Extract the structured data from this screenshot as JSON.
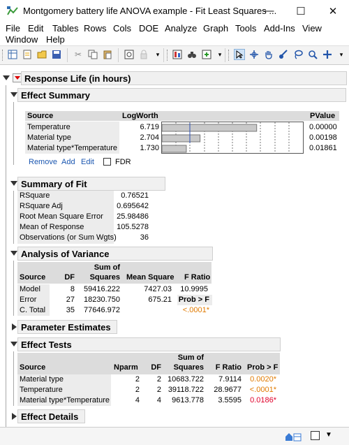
{
  "window": {
    "title": "Montgomery battery life ANOVA example - Fit Least Squares ...",
    "minimize": "—",
    "maximize": "☐",
    "close": "✕"
  },
  "menu": [
    "File",
    "Edit",
    "Tables",
    "Rows",
    "Cols",
    "DOE",
    "Analyze",
    "Graph",
    "Tools",
    "Add-Ins",
    "View",
    "Window",
    "Help"
  ],
  "report": {
    "title": "Response Life (in hours)",
    "effect_summary": {
      "title": "Effect Summary",
      "headers": {
        "source": "Source",
        "logworth": "LogWorth",
        "pvalue": "PValue"
      },
      "rows": [
        {
          "source": "Temperature",
          "logworth": "6.719",
          "pvalue": "0.00000",
          "bar": 6.719
        },
        {
          "source": "Material type",
          "logworth": "2.704",
          "pvalue": "0.00198",
          "bar": 2.704
        },
        {
          "source": "Material type*Temperature",
          "logworth": "1.730",
          "pvalue": "0.01861",
          "bar": 1.73
        }
      ],
      "links": {
        "remove": "Remove",
        "add": "Add",
        "edit": "Edit",
        "fdr": "FDR"
      }
    },
    "summary_of_fit": {
      "title": "Summary of Fit",
      "rows": [
        {
          "label": "RSquare",
          "value": "0.76521"
        },
        {
          "label": "RSquare Adj",
          "value": "0.695642"
        },
        {
          "label": "Root Mean Square Error",
          "value": "25.98486"
        },
        {
          "label": "Mean of Response",
          "value": "105.5278"
        },
        {
          "label": "Observations (or Sum Wgts)",
          "value": "36"
        }
      ]
    },
    "anova": {
      "title": "Analysis of Variance",
      "headers": {
        "source": "Source",
        "df": "DF",
        "ss_top": "Sum of",
        "ss_bottom": "Squares",
        "ms": "Mean Square",
        "f": "F Ratio"
      },
      "rows": [
        {
          "source": "Model",
          "df": "8",
          "ss": "59416.222",
          "ms": "7427.03",
          "f": "10.9995"
        },
        {
          "source": "Error",
          "df": "27",
          "ss": "18230.750",
          "ms": "675.21",
          "f": "Prob > F"
        },
        {
          "source": "C. Total",
          "df": "35",
          "ss": "77646.972",
          "ms": "",
          "f": "<.0001*"
        }
      ]
    },
    "parameter_estimates": {
      "title": "Parameter Estimates"
    },
    "effect_tests": {
      "title": "Effect Tests",
      "headers": {
        "source": "Source",
        "nparm": "Nparm",
        "df": "DF",
        "ss_top": "Sum of",
        "ss_bottom": "Squares",
        "f": "F Ratio",
        "p": "Prob > F"
      },
      "rows": [
        {
          "source": "Material type",
          "nparm": "2",
          "df": "2",
          "ss": "10683.722",
          "f": "7.9114",
          "p": "0.0020*"
        },
        {
          "source": "Temperature",
          "nparm": "2",
          "df": "2",
          "ss": "39118.722",
          "f": "28.9677",
          "p": "<.0001*"
        },
        {
          "source": "Material type*Temperature",
          "nparm": "4",
          "df": "4",
          "ss": "9613.778",
          "f": "3.5595",
          "p": "0.0186*"
        }
      ]
    },
    "effect_details": {
      "title": "Effect Details"
    }
  },
  "colors": {
    "pvalue_orange": "#e07a00",
    "pvalue_red": "#e0002a",
    "link": "#1a56b0"
  }
}
